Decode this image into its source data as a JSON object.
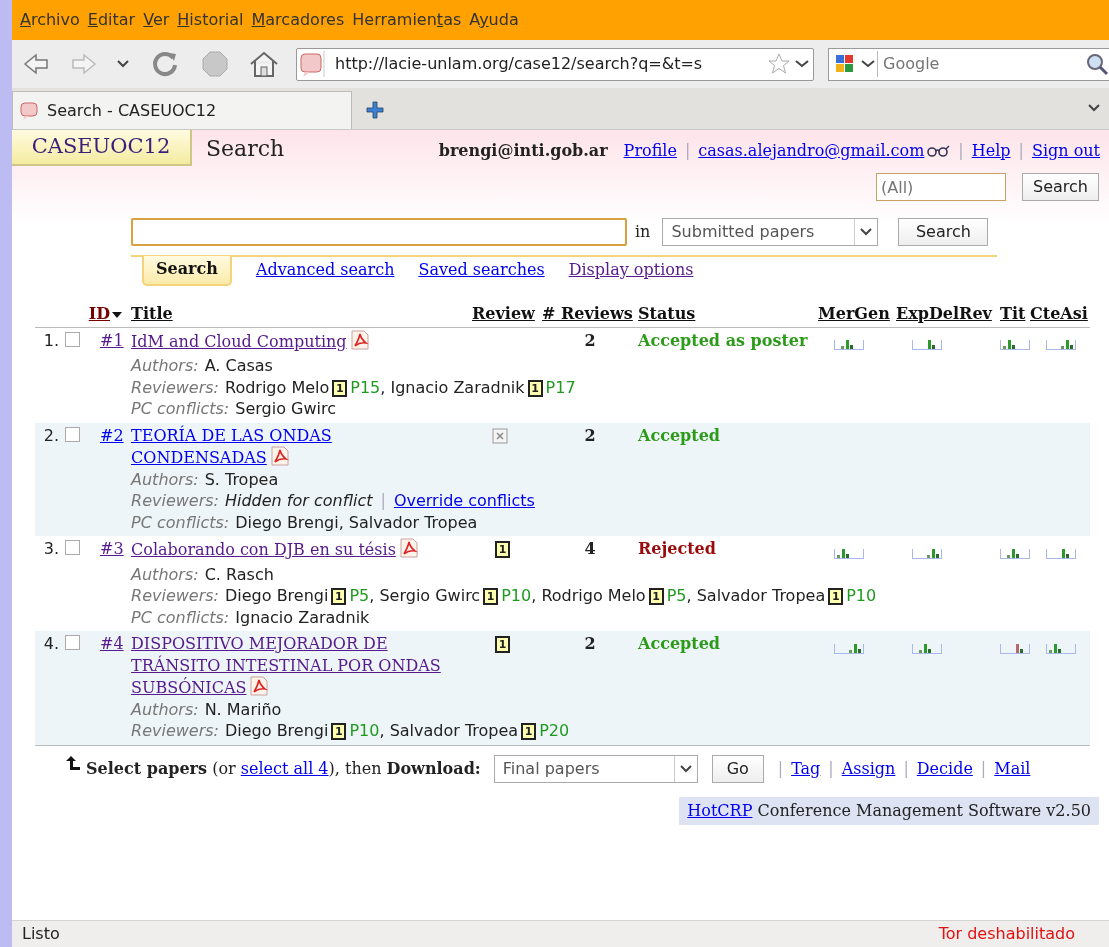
{
  "browser": {
    "menu": [
      {
        "key": "A",
        "rest": "rchivo"
      },
      {
        "key": "E",
        "rest": "ditar"
      },
      {
        "key": "V",
        "rest": "er"
      },
      {
        "key": "H",
        "rest": "istorial"
      },
      {
        "key": "M",
        "rest": "arcadores"
      },
      {
        "start": "Herramien",
        "key": "t",
        "rest": "as"
      },
      {
        "start": "A",
        "key": "y",
        "rest": "uda"
      }
    ],
    "url": "http://lacie-unlam.org/case12/search?q=&t=s",
    "search_placeholder": "Google",
    "tab": "Search - CASEUOC12"
  },
  "site": {
    "logo": "CASEUOC12",
    "page_title": "Search",
    "user": "brengi@inti.gob.ar",
    "separator": "|",
    "links": [
      {
        "label": "Profile",
        "kind": "plain"
      },
      {
        "label": "casas.alejandro@gmail.com",
        "kind": "acting"
      },
      {
        "label": "Help",
        "kind": "plain"
      },
      {
        "label": "Sign out",
        "kind": "plain"
      }
    ],
    "quick_search": {
      "placeholder": "(All)",
      "button": "Search"
    }
  },
  "search": {
    "in_label": "in",
    "scope": "Submitted papers",
    "button": "Search",
    "tabs": [
      {
        "label": "Search",
        "selected": true
      },
      {
        "label": "Advanced search",
        "selected": false,
        "visited": false
      },
      {
        "label": "Saved searches",
        "selected": false,
        "visited": false
      },
      {
        "label": "Display options",
        "selected": false,
        "visited": true
      }
    ]
  },
  "table": {
    "columns": [
      {
        "label": "ID",
        "sorted": true
      },
      {
        "label": "Title",
        "sorted": false
      },
      {
        "label": "Review",
        "sorted": false
      },
      {
        "label": "# Reviews",
        "sorted": false
      },
      {
        "label": "Status",
        "sorted": false
      },
      {
        "label": "MerGen",
        "sorted": false
      },
      {
        "label": "ExpDelRev",
        "sorted": false
      },
      {
        "label": "Tit",
        "sorted": false
      },
      {
        "label": "CteAsi",
        "sorted": false
      }
    ],
    "papers": [
      {
        "number": "1.",
        "checked": false,
        "id": "#1",
        "title": "IdM and Cloud Computing",
        "visited": true,
        "review_count": "2",
        "status": "Accepted as poster",
        "color": "#2c9b1a",
        "scores_shown": true,
        "details": [
          {
            "kind": "text",
            "label": "Authors:",
            "text": "A. Casas"
          },
          {
            "kind": "reviewers",
            "label": "Reviewers:",
            "separator": ",",
            "reviewers": [
              {
                "name": "Rodrigo Melo",
                "type": "1",
                "round": "P15"
              },
              {
                "name": "Ignacio Zaradnik",
                "type": "1",
                "round": "P17"
              }
            ]
          },
          {
            "kind": "text",
            "label": "PC conflicts:",
            "text": "Sergio Gwirc"
          }
        ]
      },
      {
        "number": "2.",
        "checked": false,
        "id": "#2",
        "title": "TEORÍA DE LAS ONDAS CONDENSADAS",
        "visited": false,
        "review_mark": {
          "kind": "conflict"
        },
        "review_count": "2",
        "status": "Accepted",
        "color": "#2c9b1a",
        "scores_shown": false,
        "details": [
          {
            "kind": "text",
            "label": "Authors:",
            "text": "S. Tropea"
          },
          {
            "kind": "hidden",
            "label": "Reviewers:",
            "text": "Hidden for conflict",
            "separator": "|",
            "link": "Override conflicts"
          },
          {
            "kind": "text",
            "label": "PC conflicts:",
            "text": "Diego Brengi, Salvador Tropea"
          }
        ]
      },
      {
        "number": "3.",
        "checked": false,
        "id": "#3",
        "title": "Colaborando con DJB en su tésis",
        "visited": true,
        "review_mark": {
          "kind": "primary",
          "label": "1"
        },
        "review_count": "4",
        "status": "Rejected",
        "color": "#9a0a0a",
        "scores_shown": true,
        "details": [
          {
            "kind": "text",
            "label": "Authors:",
            "text": "C. Rasch"
          },
          {
            "kind": "reviewers",
            "label": "Reviewers:",
            "separator": ",",
            "reviewers": [
              {
                "name": "Diego Brengi",
                "type": "1",
                "round": "P5"
              },
              {
                "name": "Sergio Gwirc",
                "type": "1",
                "round": "P10"
              },
              {
                "name": "Rodrigo Melo",
                "type": "1",
                "round": "P5"
              },
              {
                "name": "Salvador Tropea",
                "type": "1",
                "round": "P10"
              }
            ]
          },
          {
            "kind": "text",
            "label": "PC conflicts:",
            "text": "Ignacio Zaradnik"
          }
        ]
      },
      {
        "number": "4.",
        "checked": false,
        "id": "#4",
        "title": "DISPOSITIVO MEJORADOR DE TRÁNSITO INTESTINAL POR ONDAS SUBSÓNICAS",
        "visited": true,
        "review_mark": {
          "kind": "primary",
          "label": "1"
        },
        "review_count": "2",
        "status": "Accepted",
        "color": "#2c9b1a",
        "scores_shown": true,
        "details": [
          {
            "kind": "text",
            "label": "Authors:",
            "text": "N. Mariño"
          },
          {
            "kind": "reviewers",
            "label": "Reviewers:",
            "separator": ",",
            "reviewers": [
              {
                "name": "Diego Brengi",
                "type": "1",
                "round": "P10"
              },
              {
                "name": "Salvador Tropea",
                "type": "1",
                "round": "P20"
              }
            ]
          }
        ]
      }
    ]
  },
  "footer": {
    "before": "**Select papers** (or ",
    "link": "select all 4",
    "after": "), then **Download:**",
    "download_choice": "Final papers",
    "go": "Go",
    "separator": "|",
    "actions": [
      "Tag",
      "Assign",
      "Decide",
      "Mail"
    ],
    "credit": {
      "link": "HotCRP",
      "text": "Conference Management Software v2.50"
    }
  },
  "status_bar": {
    "left": "Listo",
    "right": "Tor deshabilitado"
  }
}
